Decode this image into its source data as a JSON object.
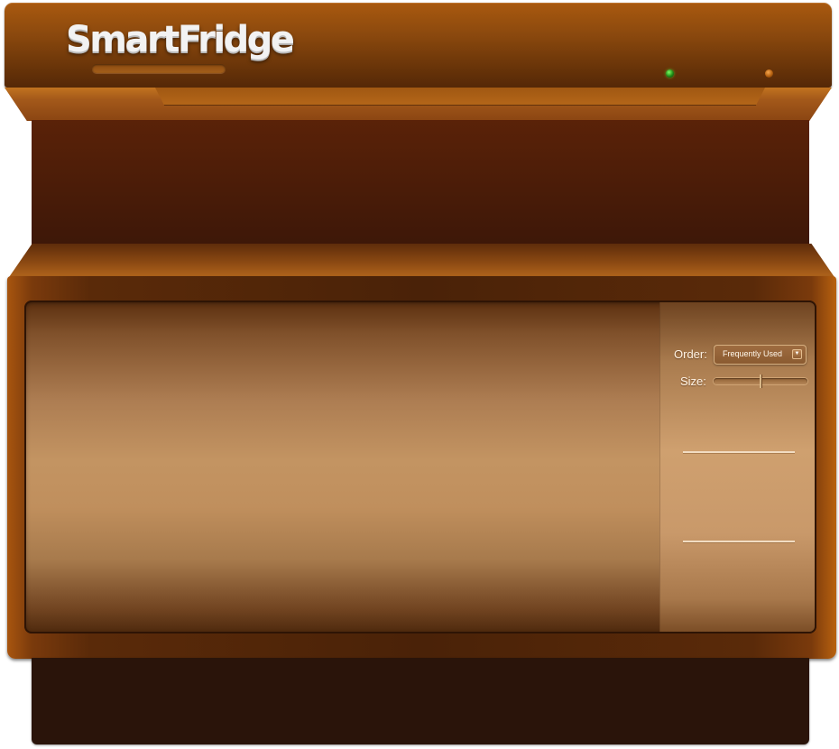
{
  "app": {
    "title": "SmartFridge"
  },
  "status_leds": [
    {
      "name": "green",
      "color": "#4ccf2c"
    },
    {
      "name": "orange",
      "color": "#c06a17"
    }
  ],
  "controls": {
    "order_label": "Order:",
    "order_value": "Frequently Used",
    "size_label": "Size:",
    "size_level": 0.5
  },
  "colors": {
    "cabinet": "#8d4a0e",
    "panel": "#cfa06f",
    "base": "#2a140a"
  }
}
